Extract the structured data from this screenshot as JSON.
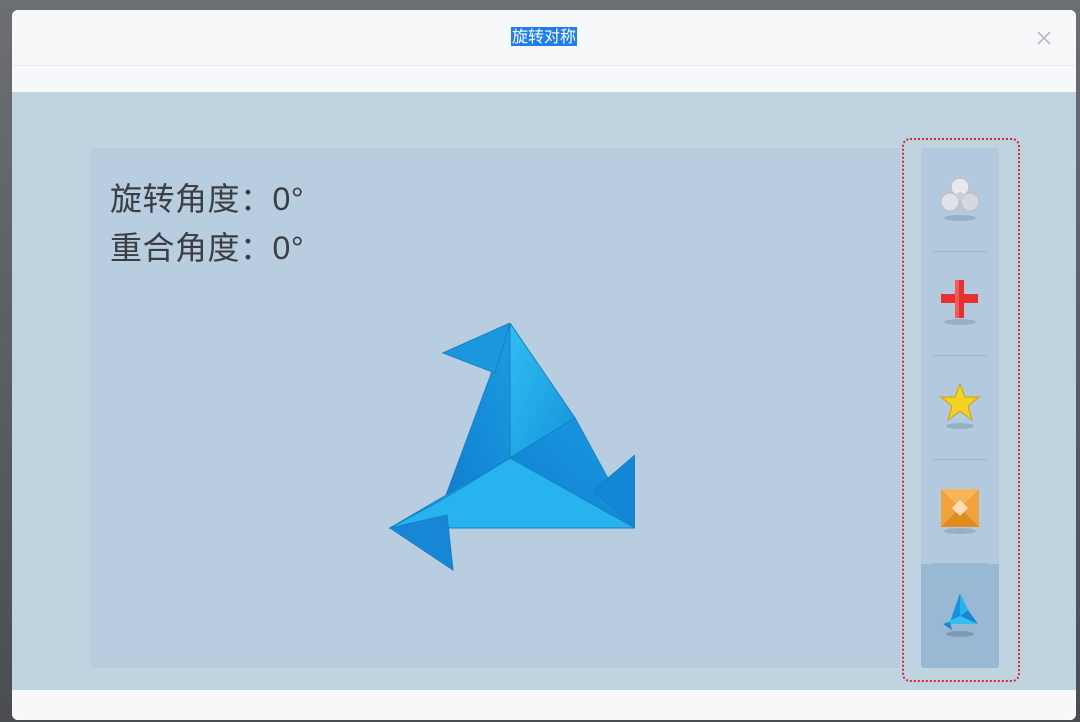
{
  "dialog": {
    "title": "旋转对称",
    "close_label": "×"
  },
  "readouts": {
    "rotation_label": "旋转角度：",
    "rotation_value": "0°",
    "overlap_label": "重合角度：",
    "overlap_value": "0°"
  },
  "selector": {
    "items": [
      {
        "name": "fan-icon",
        "active": false
      },
      {
        "name": "red-cross-icon",
        "active": false
      },
      {
        "name": "star-icon",
        "active": false
      },
      {
        "name": "orange-pinwheel-icon",
        "active": false
      },
      {
        "name": "blue-pinwheel-icon",
        "active": true
      }
    ]
  },
  "colors": {
    "title_highlight": "#1e7ef0",
    "stage_bg": "#b8cddf",
    "panel_bg": "#b3c9dd",
    "active_item_bg": "#98b8d4",
    "selection_outline": "#e02428",
    "shape_blue": "#1fa3e6"
  }
}
